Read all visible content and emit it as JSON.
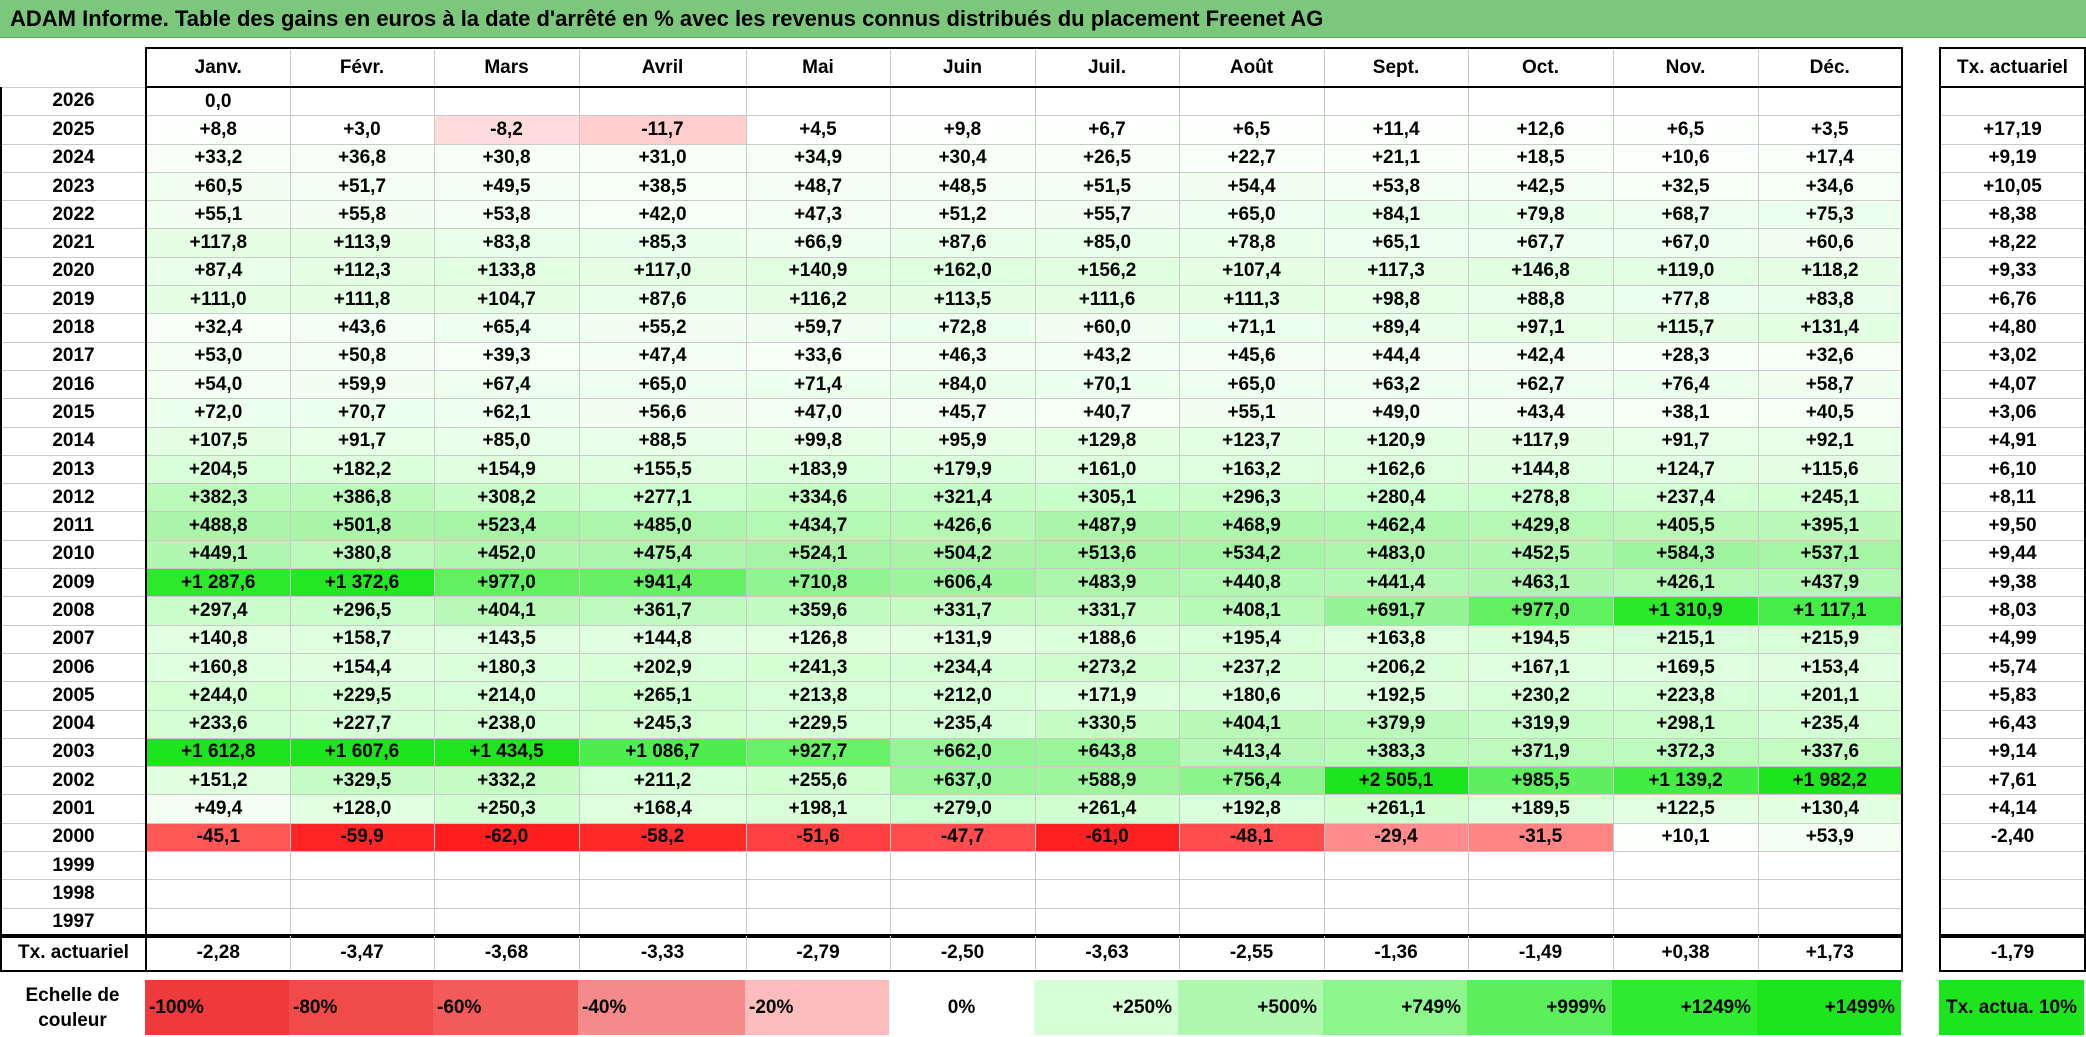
{
  "title": "ADAM Informe. Table des gains en euros à la date d'arrêté en % avec les revenus connus distribués du placement Freenet AG",
  "months": [
    "Janv.",
    "Févr.",
    "Mars",
    "Avril",
    "Mai",
    "Juin",
    "Juil.",
    "Août",
    "Sept.",
    "Oct.",
    "Nov.",
    "Déc."
  ],
  "tx_header": "Tx. actuariel",
  "rows": [
    {
      "year": "2026",
      "values": [
        "0,0",
        "",
        "",
        "",
        "",
        "",
        "",
        "",
        "",
        "",
        "",
        ""
      ],
      "tx": ""
    },
    {
      "year": "2025",
      "values": [
        "+8,8",
        "+3,0",
        "-8,2",
        "-11,7",
        "+4,5",
        "+9,8",
        "+6,7",
        "+6,5",
        "+11,4",
        "+12,6",
        "+6,5",
        "+3,5"
      ],
      "tx": "+17,19"
    },
    {
      "year": "2024",
      "values": [
        "+33,2",
        "+36,8",
        "+30,8",
        "+31,0",
        "+34,9",
        "+30,4",
        "+26,5",
        "+22,7",
        "+21,1",
        "+18,5",
        "+10,6",
        "+17,4"
      ],
      "tx": "+9,19"
    },
    {
      "year": "2023",
      "values": [
        "+60,5",
        "+51,7",
        "+49,5",
        "+38,5",
        "+48,7",
        "+48,5",
        "+51,5",
        "+54,4",
        "+53,8",
        "+42,5",
        "+32,5",
        "+34,6"
      ],
      "tx": "+10,05"
    },
    {
      "year": "2022",
      "values": [
        "+55,1",
        "+55,8",
        "+53,8",
        "+42,0",
        "+47,3",
        "+51,2",
        "+55,7",
        "+65,0",
        "+84,1",
        "+79,8",
        "+68,7",
        "+75,3"
      ],
      "tx": "+8,38"
    },
    {
      "year": "2021",
      "values": [
        "+117,8",
        "+113,9",
        "+83,8",
        "+85,3",
        "+66,9",
        "+87,6",
        "+85,0",
        "+78,8",
        "+65,1",
        "+67,7",
        "+67,0",
        "+60,6"
      ],
      "tx": "+8,22"
    },
    {
      "year": "2020",
      "values": [
        "+87,4",
        "+112,3",
        "+133,8",
        "+117,0",
        "+140,9",
        "+162,0",
        "+156,2",
        "+107,4",
        "+117,3",
        "+146,8",
        "+119,0",
        "+118,2"
      ],
      "tx": "+9,33"
    },
    {
      "year": "2019",
      "values": [
        "+111,0",
        "+111,8",
        "+104,7",
        "+87,6",
        "+116,2",
        "+113,5",
        "+111,6",
        "+111,3",
        "+98,8",
        "+88,8",
        "+77,8",
        "+83,8"
      ],
      "tx": "+6,76"
    },
    {
      "year": "2018",
      "values": [
        "+32,4",
        "+43,6",
        "+65,4",
        "+55,2",
        "+59,7",
        "+72,8",
        "+60,0",
        "+71,1",
        "+89,4",
        "+97,1",
        "+115,7",
        "+131,4"
      ],
      "tx": "+4,80"
    },
    {
      "year": "2017",
      "values": [
        "+53,0",
        "+50,8",
        "+39,3",
        "+47,4",
        "+33,6",
        "+46,3",
        "+43,2",
        "+45,6",
        "+44,4",
        "+42,4",
        "+28,3",
        "+32,6"
      ],
      "tx": "+3,02"
    },
    {
      "year": "2016",
      "values": [
        "+54,0",
        "+59,9",
        "+67,4",
        "+65,0",
        "+71,4",
        "+84,0",
        "+70,1",
        "+65,0",
        "+63,2",
        "+62,7",
        "+76,4",
        "+58,7"
      ],
      "tx": "+4,07"
    },
    {
      "year": "2015",
      "values": [
        "+72,0",
        "+70,7",
        "+62,1",
        "+56,6",
        "+47,0",
        "+45,7",
        "+40,7",
        "+55,1",
        "+49,0",
        "+43,4",
        "+38,1",
        "+40,5"
      ],
      "tx": "+3,06"
    },
    {
      "year": "2014",
      "values": [
        "+107,5",
        "+91,7",
        "+85,0",
        "+88,5",
        "+99,8",
        "+95,9",
        "+129,8",
        "+123,7",
        "+120,9",
        "+117,9",
        "+91,7",
        "+92,1"
      ],
      "tx": "+4,91"
    },
    {
      "year": "2013",
      "values": [
        "+204,5",
        "+182,2",
        "+154,9",
        "+155,5",
        "+183,9",
        "+179,9",
        "+161,0",
        "+163,2",
        "+162,6",
        "+144,8",
        "+124,7",
        "+115,6"
      ],
      "tx": "+6,10"
    },
    {
      "year": "2012",
      "values": [
        "+382,3",
        "+386,8",
        "+308,2",
        "+277,1",
        "+334,6",
        "+321,4",
        "+305,1",
        "+296,3",
        "+280,4",
        "+278,8",
        "+237,4",
        "+245,1"
      ],
      "tx": "+8,11"
    },
    {
      "year": "2011",
      "values": [
        "+488,8",
        "+501,8",
        "+523,4",
        "+485,0",
        "+434,7",
        "+426,6",
        "+487,9",
        "+468,9",
        "+462,4",
        "+429,8",
        "+405,5",
        "+395,1"
      ],
      "tx": "+9,50"
    },
    {
      "year": "2010",
      "values": [
        "+449,1",
        "+380,8",
        "+452,0",
        "+475,4",
        "+524,1",
        "+504,2",
        "+513,6",
        "+534,2",
        "+483,0",
        "+452,5",
        "+584,3",
        "+537,1"
      ],
      "tx": "+9,44"
    },
    {
      "year": "2009",
      "values": [
        "+1 287,6",
        "+1 372,6",
        "+977,0",
        "+941,4",
        "+710,8",
        "+606,4",
        "+483,9",
        "+440,8",
        "+441,4",
        "+463,1",
        "+426,1",
        "+437,9"
      ],
      "tx": "+9,38"
    },
    {
      "year": "2008",
      "values": [
        "+297,4",
        "+296,5",
        "+404,1",
        "+361,7",
        "+359,6",
        "+331,7",
        "+331,7",
        "+408,1",
        "+691,7",
        "+977,0",
        "+1 310,9",
        "+1 117,1"
      ],
      "tx": "+8,03"
    },
    {
      "year": "2007",
      "values": [
        "+140,8",
        "+158,7",
        "+143,5",
        "+144,8",
        "+126,8",
        "+131,9",
        "+188,6",
        "+195,4",
        "+163,8",
        "+194,5",
        "+215,1",
        "+215,9"
      ],
      "tx": "+4,99"
    },
    {
      "year": "2006",
      "values": [
        "+160,8",
        "+154,4",
        "+180,3",
        "+202,9",
        "+241,3",
        "+234,4",
        "+273,2",
        "+237,2",
        "+206,2",
        "+167,1",
        "+169,5",
        "+153,4"
      ],
      "tx": "+5,74"
    },
    {
      "year": "2005",
      "values": [
        "+244,0",
        "+229,5",
        "+214,0",
        "+265,1",
        "+213,8",
        "+212,0",
        "+171,9",
        "+180,6",
        "+192,5",
        "+230,2",
        "+223,8",
        "+201,1"
      ],
      "tx": "+5,83"
    },
    {
      "year": "2004",
      "values": [
        "+233,6",
        "+227,7",
        "+238,0",
        "+245,3",
        "+229,5",
        "+235,4",
        "+330,5",
        "+404,1",
        "+379,9",
        "+319,9",
        "+298,1",
        "+235,4"
      ],
      "tx": "+6,43"
    },
    {
      "year": "2003",
      "values": [
        "+1 612,8",
        "+1 607,6",
        "+1 434,5",
        "+1 086,7",
        "+927,7",
        "+662,0",
        "+643,8",
        "+413,4",
        "+383,3",
        "+371,9",
        "+372,3",
        "+337,6"
      ],
      "tx": "+9,14"
    },
    {
      "year": "2002",
      "values": [
        "+151,2",
        "+329,5",
        "+332,2",
        "+211,2",
        "+255,6",
        "+637,0",
        "+588,9",
        "+756,4",
        "+2 505,1",
        "+985,5",
        "+1 139,2",
        "+1 982,2"
      ],
      "tx": "+7,61"
    },
    {
      "year": "2001",
      "values": [
        "+49,4",
        "+128,0",
        "+250,3",
        "+168,4",
        "+198,1",
        "+279,0",
        "+261,4",
        "+192,8",
        "+261,1",
        "+189,5",
        "+122,5",
        "+130,4"
      ],
      "tx": "+4,14"
    },
    {
      "year": "2000",
      "values": [
        "-45,1",
        "-59,9",
        "-62,0",
        "-58,2",
        "-51,6",
        "-47,7",
        "-61,0",
        "-48,1",
        "-29,4",
        "-31,5",
        "+10,1",
        "+53,9"
      ],
      "tx": "-2,40"
    },
    {
      "year": "1999",
      "values": [
        "",
        "",
        "",
        "",
        "",
        "",
        "",
        "",
        "",
        "",
        "",
        ""
      ],
      "tx": ""
    },
    {
      "year": "1998",
      "values": [
        "",
        "",
        "",
        "",
        "",
        "",
        "",
        "",
        "",
        "",
        "",
        ""
      ],
      "tx": ""
    },
    {
      "year": "1997",
      "values": [
        "",
        "",
        "",
        "",
        "",
        "",
        "",
        "",
        "",
        "",
        "",
        ""
      ],
      "tx": ""
    }
  ],
  "summary": {
    "label": "Tx. actuariel",
    "values": [
      "-2,28",
      "-3,47",
      "-3,68",
      "-3,33",
      "-2,79",
      "-2,50",
      "-3,63",
      "-2,55",
      "-1,36",
      "-1,49",
      "+0,38",
      "+1,73"
    ],
    "total": "-1,79"
  },
  "scale": {
    "label": "Echelle de couleur",
    "items": [
      "-100%",
      "-80%",
      "-60%",
      "-40%",
      "-20%",
      "0%",
      "+250%",
      "+500%",
      "+749%",
      "+999%",
      "+1249%",
      "+1499%"
    ],
    "colors": [
      "#ee3a3a",
      "#f14a4a",
      "#f35b5b",
      "#f68a8a",
      "#fbbcbc",
      "#ffffff",
      "#d6ffd6",
      "#b0f7b0",
      "#8cf58c",
      "#5bef5b",
      "#2fea2f",
      "#1de51d"
    ],
    "tx_label": "Tx. actua. 10%",
    "tx_color": "#1de51d"
  }
}
